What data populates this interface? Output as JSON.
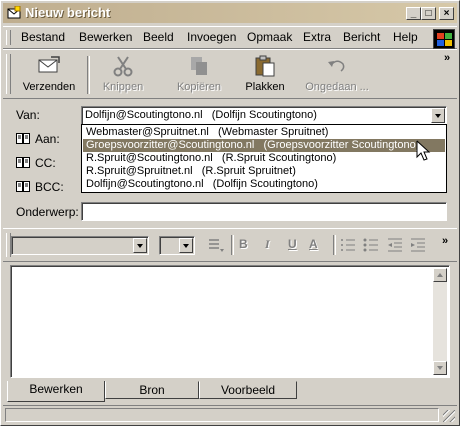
{
  "window": {
    "title": "Nieuw bericht"
  },
  "menu": {
    "items": [
      "Bestand",
      "Bewerken",
      "Beeld",
      "Invoegen",
      "Opmaak",
      "Extra",
      "Bericht",
      "Help"
    ]
  },
  "toolbar": {
    "send": "Verzenden",
    "cut": "Knippen",
    "copy": "Kopiëren",
    "paste": "Plakken",
    "undo": "Ongedaan ...",
    "more": "»"
  },
  "fields": {
    "from_label": "Van:",
    "from_value": "Dolfijn@Scoutingtono.nl   (Dolfijn Scoutingtono)",
    "to_label": "Aan:",
    "cc_label": "CC:",
    "bcc_label": "BCC:",
    "subject_label": "Onderwerp:"
  },
  "dropdown": {
    "options": [
      "Webmaster@Spruitnet.nl   (Webmaster Spruitnet)",
      "Groepsvoorzitter@Scoutingtono.nl   (Groepsvoorzitter Scoutingtono)",
      "R.Spruit@Scoutingtono.nl   (R.Spruit Scoutingtono)",
      "R.Spruit@Spruitnet.nl   (R.Spruit Spruitnet)",
      "Dolfijn@Scoutingtono.nl   (Dolfijn Scoutingtono)"
    ],
    "selected_index": 1
  },
  "format_toolbar": {
    "bold": "B",
    "italic": "I",
    "underline": "U",
    "font_color": "A",
    "more": "»"
  },
  "tabs": [
    "Bewerken",
    "Bron",
    "Voorbeeld"
  ],
  "active_tab": 0,
  "colors": {
    "titlebar": "#bfae8f",
    "selection": "#827861",
    "face": "#d4d0c8"
  }
}
